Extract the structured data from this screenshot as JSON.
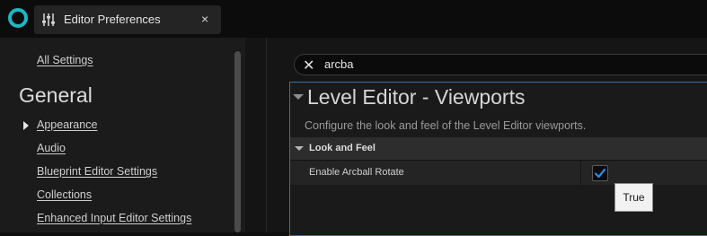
{
  "window": {
    "tab_title": "Editor Preferences",
    "tab_icon": "sliders-icon",
    "close_glyph": "×"
  },
  "sidebar": {
    "all_settings": "All Settings",
    "heading": "General",
    "items": [
      {
        "label": "Appearance",
        "selected": true
      },
      {
        "label": "Audio"
      },
      {
        "label": "Blueprint Editor Settings"
      },
      {
        "label": "Collections"
      },
      {
        "label": "Enhanced Input Editor Settings"
      }
    ]
  },
  "search": {
    "value": "arcba",
    "clear_glyph": "✕"
  },
  "section": {
    "title": "Level Editor - Viewports",
    "description": "Configure the look and feel of the Level Editor viewports."
  },
  "category": {
    "label": "Look and Feel"
  },
  "property": {
    "label": "Enable Arcball Rotate",
    "checked": true
  },
  "tooltip": {
    "text": "True"
  },
  "colors": {
    "accent_teal": "#1fb7c3",
    "panel_border": "#3a6fa6",
    "checkbox_check": "#2f8be0"
  }
}
